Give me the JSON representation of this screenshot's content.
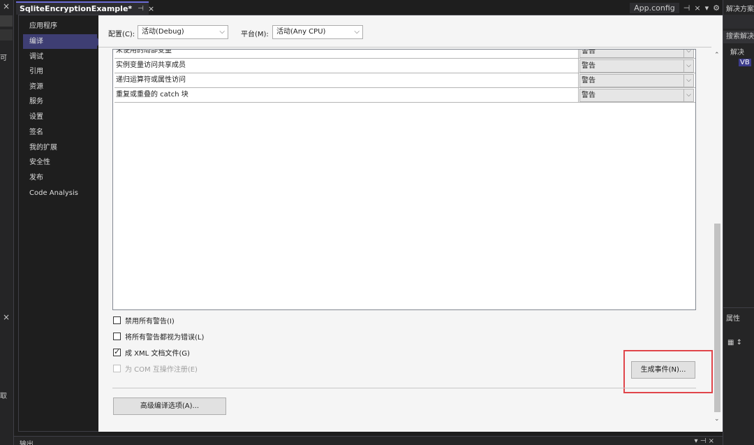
{
  "left_strip": {
    "close1": "×",
    "text1": "可",
    "close2": "×",
    "text2": "取"
  },
  "doc_tab": {
    "title": "SqliteEncryptionExample*",
    "pin": "⊣",
    "close": "×"
  },
  "right_tab": {
    "name": "App.config",
    "pin": "⊣",
    "close": "×",
    "menu": "▾",
    "settings": "⚙"
  },
  "nav": {
    "items": [
      {
        "label": "应用程序"
      },
      {
        "label": "编译"
      },
      {
        "label": "调试"
      },
      {
        "label": "引用"
      },
      {
        "label": "资源"
      },
      {
        "label": "服务"
      },
      {
        "label": "设置"
      },
      {
        "label": "签名"
      },
      {
        "label": "我的扩展"
      },
      {
        "label": "安全性"
      },
      {
        "label": "发布"
      },
      {
        "label": "Code Analysis"
      }
    ]
  },
  "config": {
    "config_label": "配置(C):",
    "config_value": "活动(Debug)",
    "platform_label": "平台(M):",
    "platform_value": "活动(Any CPU)"
  },
  "grid": {
    "rows": [
      {
        "name": "未使用的局部变量",
        "value": "警告"
      },
      {
        "name": "实例变量访问共享成员",
        "value": "警告"
      },
      {
        "name": "递归运算符或属性访问",
        "value": "警告"
      },
      {
        "name": "重复或重叠的 catch 块",
        "value": "警告"
      }
    ]
  },
  "options": {
    "disable_all": "禁用所有警告(I)",
    "treat_as_errors": "将所有警告都视为错误(L)",
    "xml_doc": "成 XML 文档文件(G)",
    "com_interop": "为 COM 互操作注册(E)"
  },
  "buttons": {
    "build_events": "生成事件(N)...",
    "advanced": "高级编译选项(A)..."
  },
  "solution_explorer": {
    "title": "解决方案资",
    "search": "搜索解决",
    "root": "解决",
    "project_tag": "VB"
  },
  "properties": {
    "title": "属性"
  },
  "output": {
    "title": "输出",
    "ctrl": "▾ ⊣ ×"
  },
  "colors": {
    "accent": "#3e3e73",
    "highlight": "#e0454a"
  }
}
